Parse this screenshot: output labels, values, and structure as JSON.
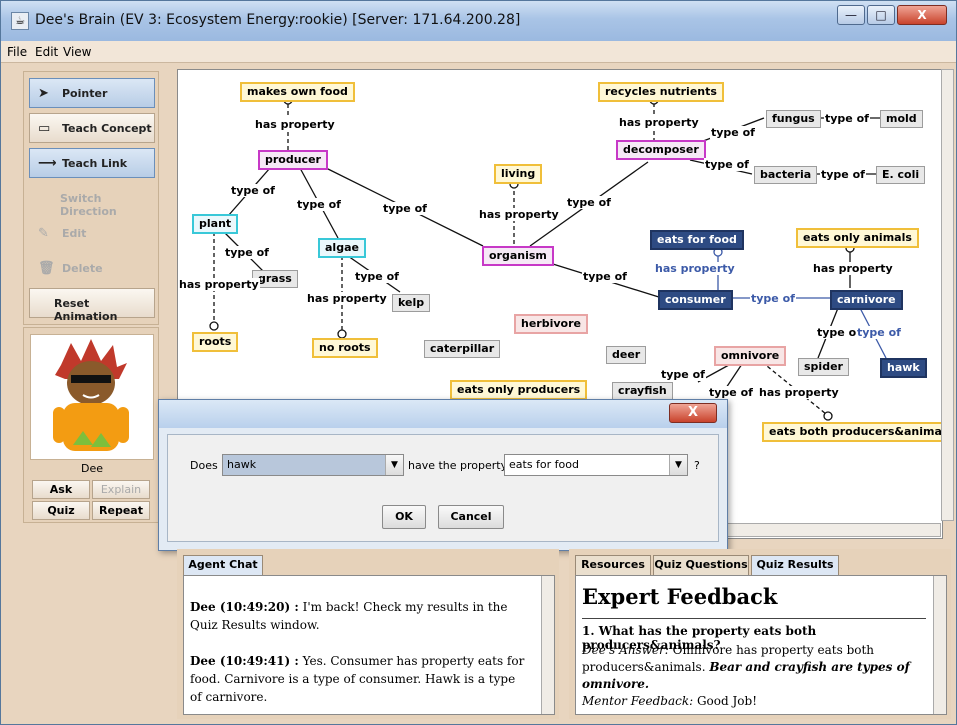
{
  "window": {
    "title": "Dee's Brain (EV 3: Ecosystem Energy:rookie) [Server: 171.64.200.28]",
    "minimize": "—",
    "maximize": "□",
    "close": "X"
  },
  "menu": [
    "File",
    "Edit",
    "View"
  ],
  "toolbox": {
    "pointer": "Pointer",
    "teach_concept": "Teach Concept",
    "teach_link": "Teach Link",
    "switch_direction": "Switch Direction",
    "edit": "Edit",
    "delete": "Delete",
    "reset_animation": "Reset Animation"
  },
  "agent": {
    "name": "Dee",
    "ask": "Ask",
    "explain": "Explain",
    "quiz": "Quiz",
    "repeat": "Repeat"
  },
  "concept_map": {
    "nodes": {
      "makes_own_food": "makes own food",
      "producer": "producer",
      "plant": "plant",
      "algae": "algae",
      "grass": "grass",
      "kelp": "kelp",
      "roots": "roots",
      "no_roots": "no roots",
      "caterpillar": "caterpillar",
      "herbivore": "herbivore",
      "eats_only_producers": "eats only producers",
      "living": "living",
      "organism": "organism",
      "recycles_nutrients": "recycles nutrients",
      "decomposer": "decomposer",
      "fungus": "fungus",
      "mold": "mold",
      "bacteria": "bacteria",
      "e_coli": "E. coli",
      "eats_for_food": "eats for food",
      "consumer": "consumer",
      "carnivore": "carnivore",
      "eats_only_animals": "eats only animals",
      "spider": "spider",
      "hawk": "hawk",
      "deer": "deer",
      "omnivore": "omnivore",
      "crayfish": "crayfish",
      "eats_both": "eats both producers&animals"
    },
    "links": {
      "has_property": "has property",
      "type_of": "type of"
    }
  },
  "dialog": {
    "close": "X",
    "does": "Does",
    "subject": "hawk",
    "have_the_property": "have the property",
    "property": "eats for food",
    "qmark": "?",
    "ok": "OK",
    "cancel": "Cancel"
  },
  "agent_chat": {
    "tab": "Agent Chat",
    "messages": [
      {
        "speaker": "Dee (10:49:20) :",
        "text": "I'm back! Check my results in the Quiz Results window."
      },
      {
        "speaker": "Dee (10:49:41) :",
        "text": "Yes. Consumer has property eats for food. Carnivore is a type of consumer. Hawk is a type of carnivore."
      }
    ]
  },
  "results": {
    "tabs": [
      "Resources",
      "Quiz Questions",
      "Quiz Results"
    ],
    "heading": "Expert Feedback",
    "question": "1. What has the property eats both producers&animals?",
    "answer_label": "Dee's Answer:",
    "answer_text": "Omnivore has property eats both producers&animals.",
    "answer_emph": "Bear and crayfish are types of omnivore.",
    "mentor_label": "Mentor Feedback:",
    "mentor_text": "Good Job!"
  },
  "colors": {
    "property_border": "#f0bf3a",
    "concept_border": "#c739c7",
    "instance_border": "#39c8d8",
    "highlight_fill": "#2e4b83"
  }
}
